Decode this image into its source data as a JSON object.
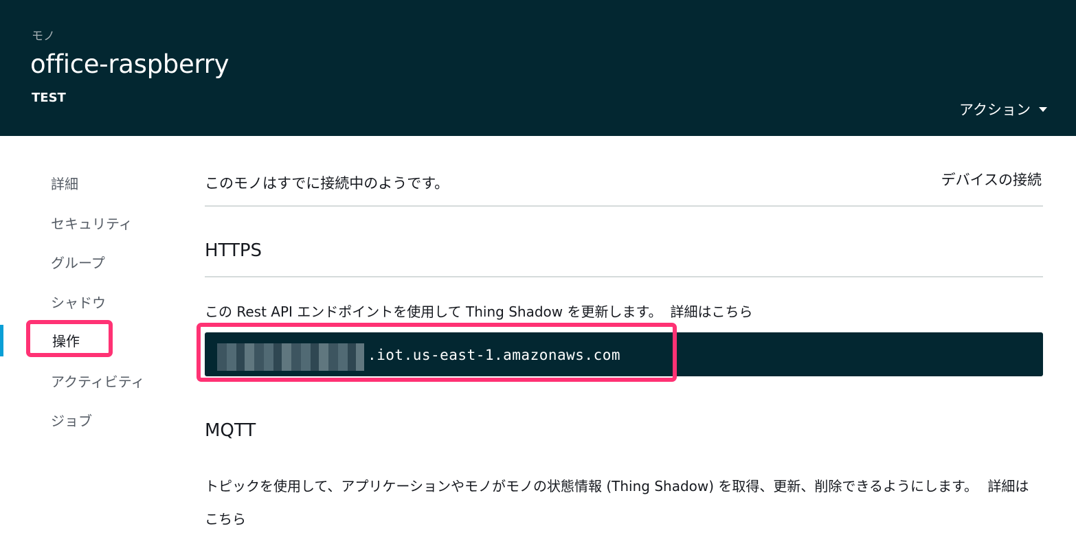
{
  "header": {
    "breadcrumb": "モノ",
    "title": "office-raspberry",
    "subtitle": "TEST",
    "action_label": "アクション"
  },
  "sidebar": {
    "items": [
      {
        "label": "詳細"
      },
      {
        "label": "セキュリティ"
      },
      {
        "label": "グループ"
      },
      {
        "label": "シャドウ"
      },
      {
        "label": "操作"
      },
      {
        "label": "アクティビティ"
      },
      {
        "label": "ジョブ"
      }
    ],
    "active_index": 4
  },
  "main": {
    "intro": "このモノはすでに接続中のようです。",
    "connect_link": "デバイスの接続",
    "https": {
      "heading": "HTTPS",
      "description": "この Rest API エンドポイントを使用して Thing Shadow を更新します。",
      "details_link": "詳細はこちら",
      "endpoint": ".iot.us-east-1.amazonaws.com"
    },
    "mqtt": {
      "heading": "MQTT",
      "description": "トピックを使用して、アプリケーションやモノがモノの状態情報 (Thing Shadow) を取得、更新、削除できるようにします。",
      "details_link": "詳細はこちら"
    }
  },
  "colors": {
    "header_bg": "#032731",
    "highlight": "#ff3274",
    "active_indicator": "#0a9fd6"
  },
  "icons": {
    "action_caret": "caret-down-icon"
  }
}
